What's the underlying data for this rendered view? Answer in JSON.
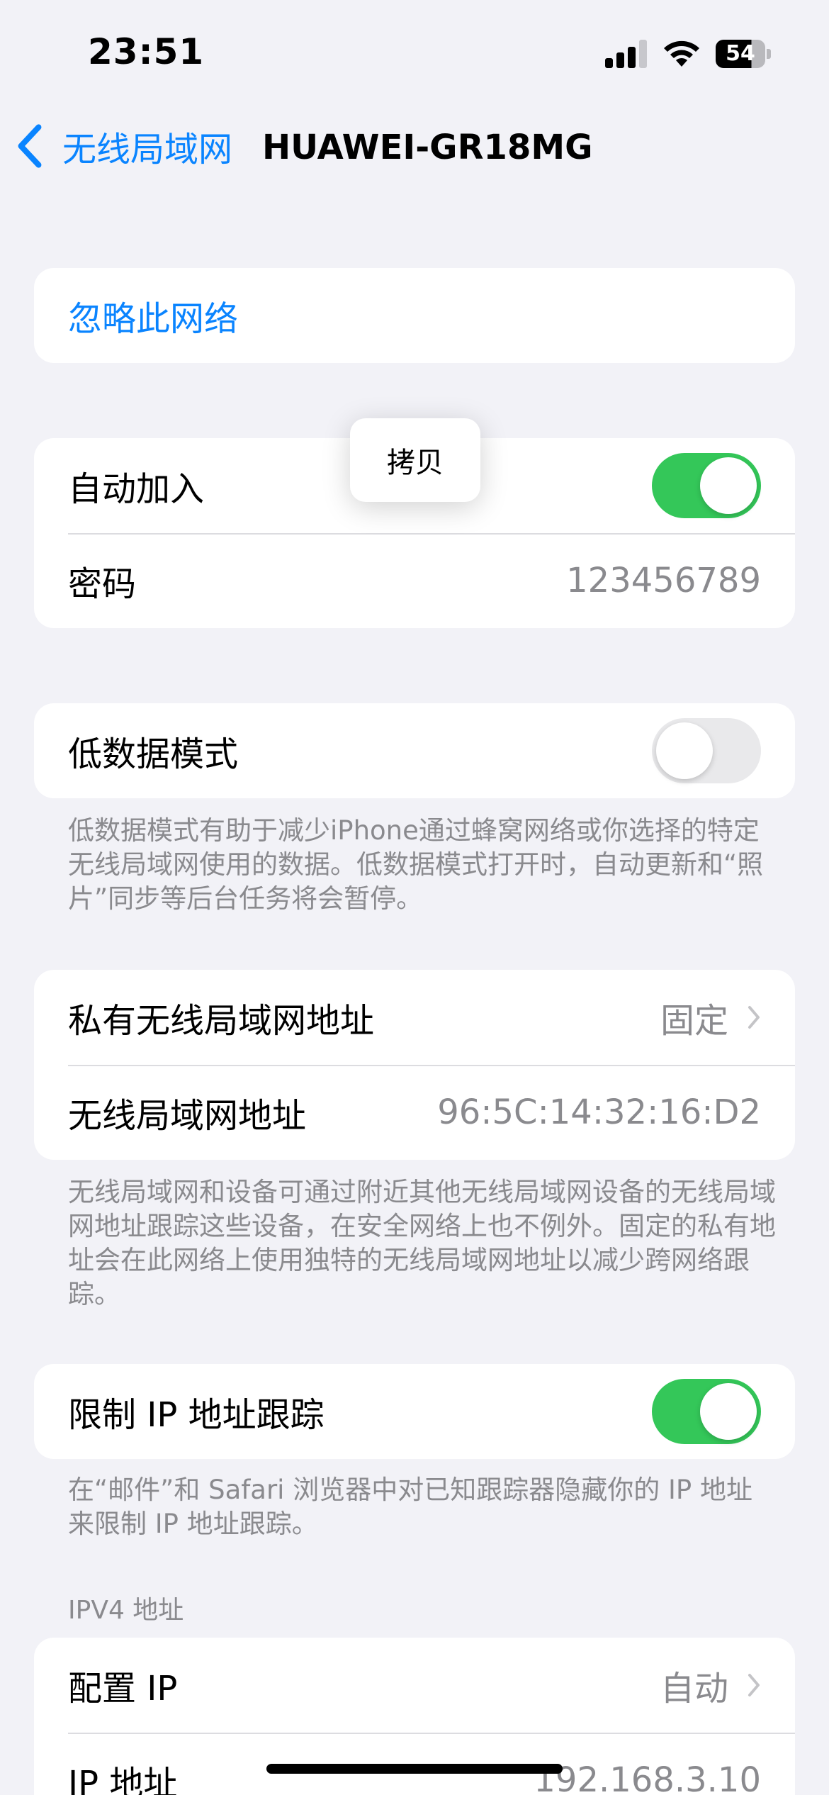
{
  "status_bar": {
    "time": "23:51",
    "battery": "54"
  },
  "nav": {
    "back_label": "无线局域网",
    "title": "HUAWEI-GR18MG"
  },
  "forget": {
    "label": "忽略此网络"
  },
  "join_group": {
    "auto_join_label": "自动加入",
    "auto_join_on": true,
    "password_label": "密码",
    "password_value": "123456789"
  },
  "copy_popup": {
    "label": "拷贝"
  },
  "low_data": {
    "label": "低数据模式",
    "on": false,
    "footnote": "低数据模式有助于减少iPhone通过蜂窝网络或你选择的特定无线局域网使用的数据。低数据模式打开时，自动更新和“照片”同步等后台任务将会暂停。"
  },
  "address_group": {
    "private_label": "私有无线局域网地址",
    "private_value": "固定",
    "wlan_label": "无线局域网地址",
    "wlan_value": "96:5C:14:32:16:D2",
    "footnote": "无线局域网和设备可通过附近其他无线局域网设备的无线局域网地址跟踪这些设备，在安全网络上也不例外。固定的私有地址会在此网络上使用独特的无线局域网地址以减少跨网络跟踪。"
  },
  "limit_ip": {
    "label": "限制 IP 地址跟踪",
    "on": true,
    "footnote": "在“邮件”和 Safari 浏览器中对已知跟踪器隐藏你的 IP 地址来限制 IP 地址跟踪。"
  },
  "ipv4": {
    "header": "IPV4 地址",
    "configure_label": "配置 IP",
    "configure_value": "自动",
    "ip_label": "IP 地址",
    "ip_value": "192.168.3.10"
  },
  "colors": {
    "accent": "#0a84ff",
    "toggle_on": "#34c759",
    "background": "#f2f2f7"
  }
}
